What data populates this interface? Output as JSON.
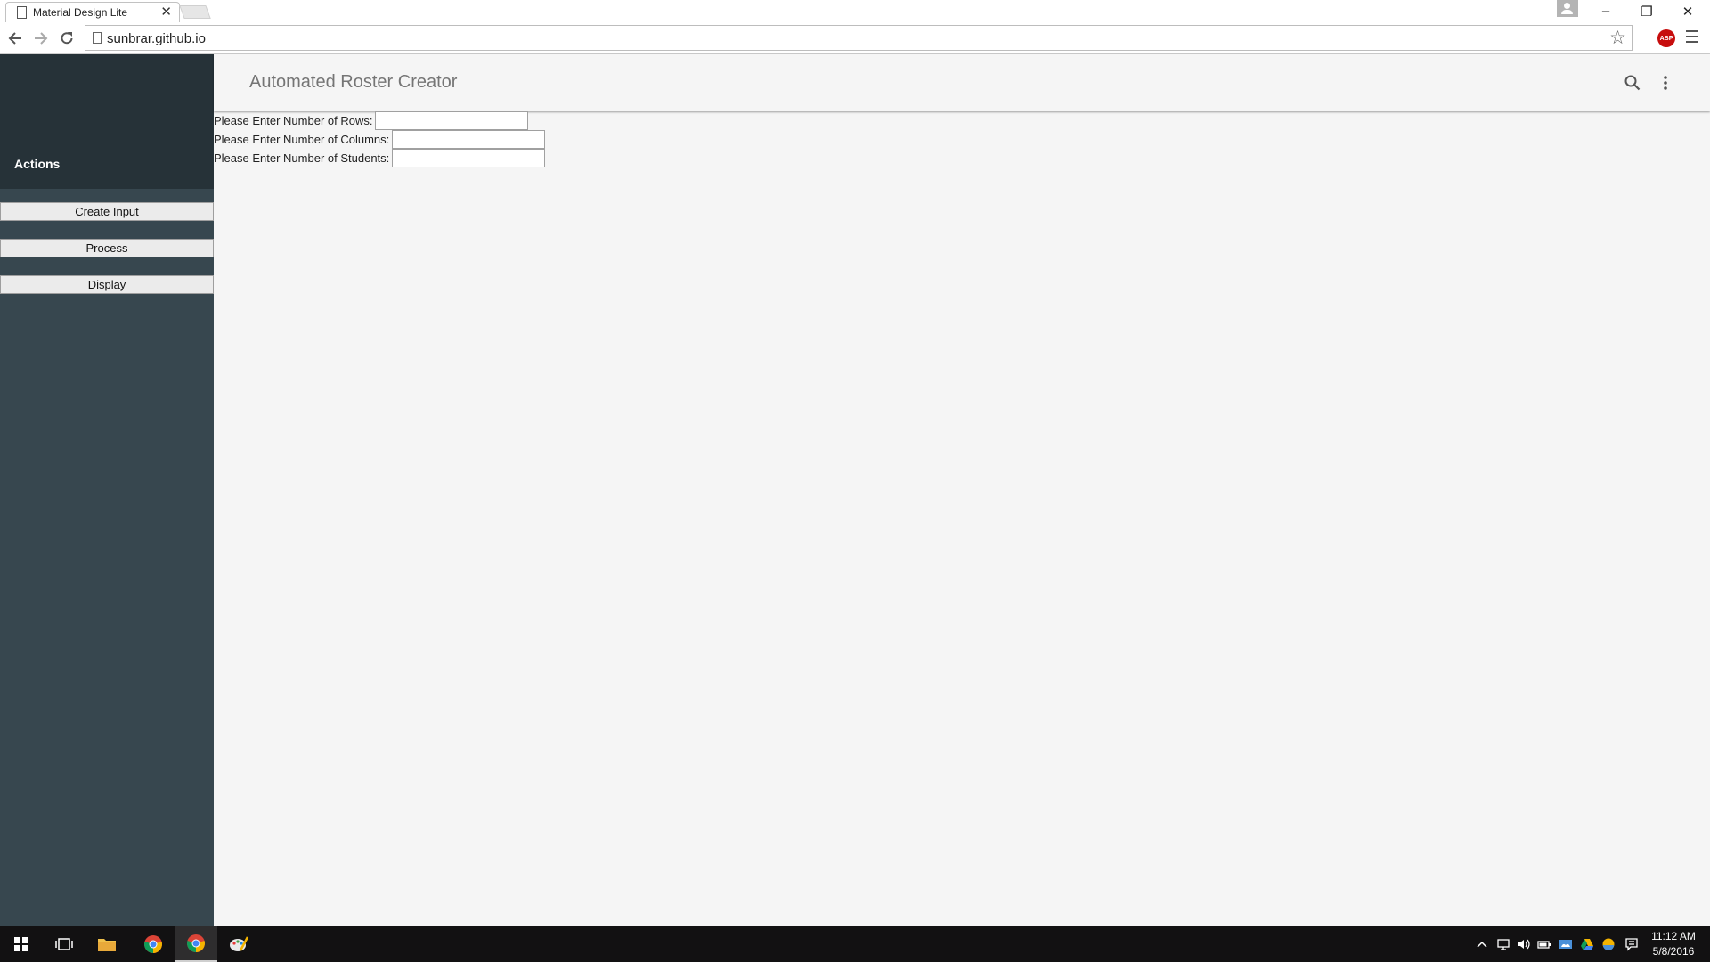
{
  "browser": {
    "tab_title": "Material Design Lite",
    "tab_close_glyph": "✕",
    "url": "sunbrar.github.io",
    "abp_badge": "ABP",
    "window_controls": {
      "minimize": "–",
      "maximize": "❐",
      "close": "✕"
    }
  },
  "app": {
    "title": "Automated Roster Creator",
    "accent_dark": "#263238",
    "drawer_color": "#37474f"
  },
  "drawer": {
    "title": "Actions",
    "buttons": [
      {
        "label": "Create Input"
      },
      {
        "label": "Process"
      },
      {
        "label": "Display"
      }
    ]
  },
  "form": {
    "rows_label": "Please Enter Number of Rows:",
    "rows_value": "",
    "columns_label": "Please Enter Number of Columns:",
    "columns_value": "",
    "students_label": "Please Enter Number of Students:",
    "students_value": ""
  },
  "taskbar": {
    "time": "11:12 AM",
    "date": "5/8/2016",
    "apps": [
      "windows-start",
      "task-view",
      "file-explorer",
      "chrome",
      "chrome-active",
      "paint"
    ]
  }
}
